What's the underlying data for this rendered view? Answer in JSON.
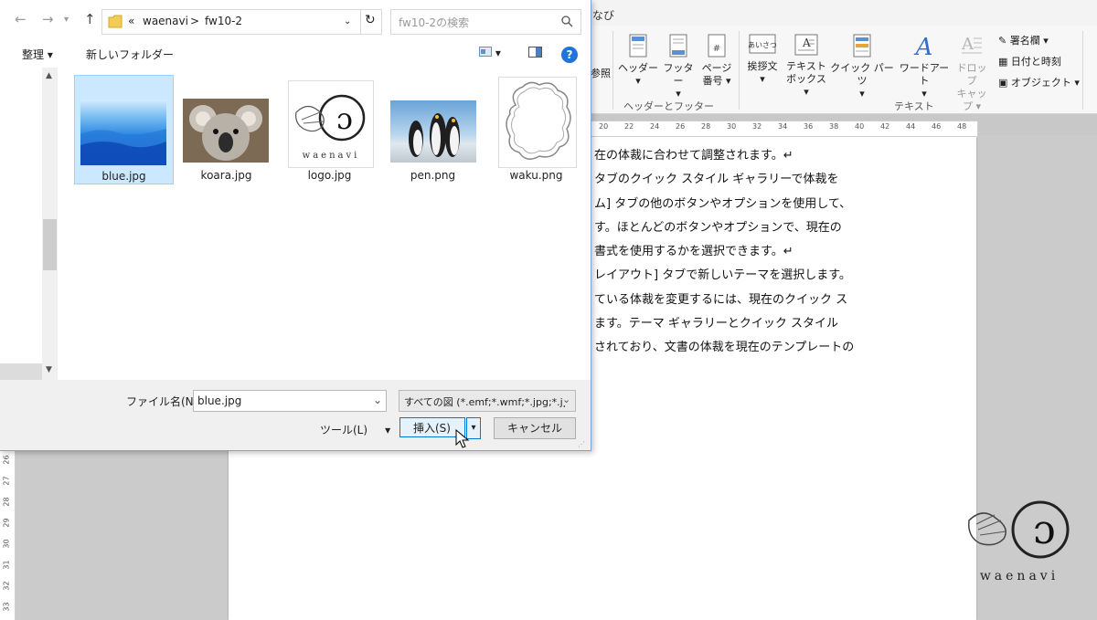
{
  "word": {
    "title_fragment": "なび",
    "ribbon": {
      "left_fragment": "参照",
      "buttons": {
        "header": "ヘッダー",
        "footer": "フッター",
        "page_num_1": "ページ",
        "page_num_2": "番号",
        "greeting_1": "挨拶文",
        "textbox_1": "テキスト",
        "textbox_2": "ボックス",
        "quickparts": "クイック パーツ",
        "wordart": "ワードアート",
        "dropcap_1": "ドロップ",
        "dropcap_2": "キャップ",
        "signature": "署名欄",
        "datetime": "日付と時刻",
        "object": "オブジェクト"
      },
      "group_labels": {
        "header_footer": "ヘッダーとフッター",
        "text": "テキスト"
      }
    },
    "ruler_numbers": [
      "20",
      "22",
      "24",
      "26",
      "28",
      "30",
      "32",
      "34",
      "36",
      "38",
      "40",
      "42",
      "44",
      "46",
      "48"
    ],
    "vruler_numbers": [
      "26",
      "27",
      "28",
      "29",
      "30",
      "31",
      "32",
      "33"
    ],
    "document_lines": [
      "在の体裁に合わせて調整されます。↵",
      "タブのクイック スタイル ギャラリーで体裁を",
      "ム] タブの他のボタンやオプションを使用して、",
      "す。ほとんどのボタンやオプションで、現在の",
      "書式を使用するかを選択できます。↵",
      "レイアウト] タブで新しいテーマを選択します。",
      "ている体裁を変更するには、現在のクイック ス",
      "ます。テーマ ギャラリーとクイック スタイル",
      "されており、文書の体裁を現在のテンプレートの"
    ],
    "watermark_text": "waenavi"
  },
  "dialog": {
    "path": {
      "prefix": "«",
      "parent": "waenavi",
      "separator": ">",
      "current": "fw10-2"
    },
    "search_placeholder": "fw10-2の検索",
    "toolbar": {
      "organize": "整理",
      "new_folder": "新しいフォルダー",
      "help": "?"
    },
    "files": [
      {
        "name": "blue.jpg",
        "selected": true
      },
      {
        "name": "koara.jpg",
        "selected": false
      },
      {
        "name": "logo.jpg",
        "selected": false
      },
      {
        "name": "pen.png",
        "selected": false
      },
      {
        "name": "waku.png",
        "selected": false
      }
    ],
    "logo_thumb_text": "waenavi",
    "filename_label": "ファイル名(N):",
    "filename_value": "blue.jpg",
    "filetype_value": "すべての図 (*.emf;*.wmf;*.jpg;*.jp",
    "tools_label": "ツール(L)",
    "insert_label": "挿入(S)",
    "cancel_label": "キャンセル"
  }
}
